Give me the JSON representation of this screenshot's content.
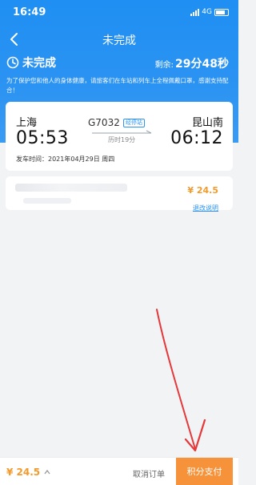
{
  "status_bar": {
    "time": "16:49",
    "network": "4G"
  },
  "nav": {
    "title": "未完成"
  },
  "order": {
    "status": "未完成",
    "remaining_label": "剩余:",
    "remaining_time": "29分48秒",
    "notice": "为了保护您和他人的身体健康，请旅客们在车站和列车上全程佩戴口罩，感谢支持配合！"
  },
  "trip": {
    "from_city": "上海",
    "to_city": "昆山南",
    "depart_time": "05:53",
    "arrive_time": "06:12",
    "train_no": "G7032",
    "tag": "经停站",
    "duration": "历时19分",
    "depart_date": "发车时间：2021年04月29日 周四"
  },
  "ticket": {
    "price": "¥ 24.5",
    "refund_label": "退改说明"
  },
  "bottom_bar": {
    "total": "¥ 24.5",
    "cancel_label": "取消订单",
    "pay_label": "积分支付"
  },
  "colors": {
    "primary": "#2b93f2",
    "accent": "#f39a2a",
    "annotation": "#e4383a"
  }
}
